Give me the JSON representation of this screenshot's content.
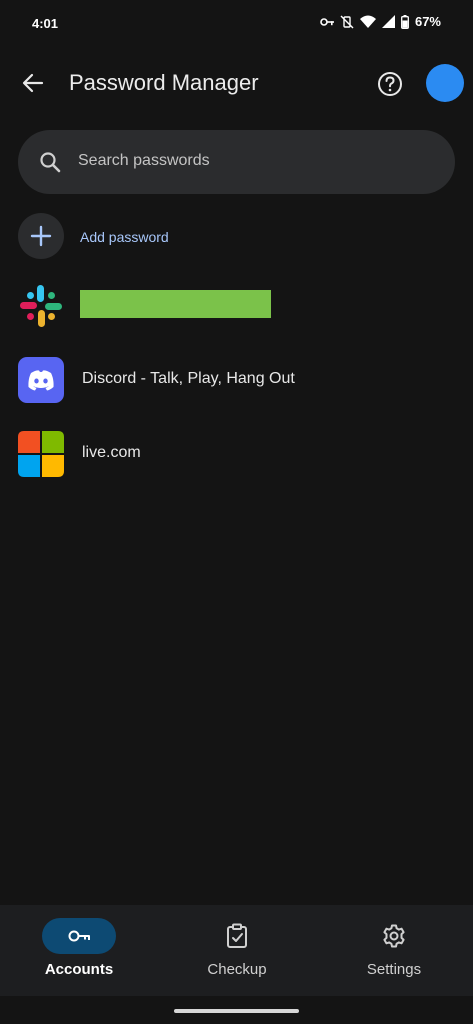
{
  "status_bar": {
    "time": "4:01",
    "battery": "67%",
    "icons": [
      "vpn-key-icon",
      "vibrate-off-icon",
      "wifi-icon",
      "signal-icon",
      "battery-icon"
    ]
  },
  "header": {
    "title": "Password Manager",
    "back_icon": "arrow-back-icon",
    "help_icon": "help-circle-icon",
    "avatar_color": "#2b8bf2"
  },
  "search": {
    "placeholder": "Search passwords"
  },
  "add_password": {
    "label": "Add password"
  },
  "passwords": [
    {
      "label": "",
      "icon": "slack-logo-icon",
      "redacted": true,
      "redaction_color": "#7bc24a"
    },
    {
      "label": "Discord - Talk, Play, Hang Out",
      "icon": "discord-logo-icon",
      "redacted": false
    },
    {
      "label": "live.com",
      "icon": "microsoft-logo-icon",
      "redacted": false
    }
  ],
  "bottom_nav": [
    {
      "label": "Accounts",
      "icon": "key-icon",
      "active": true
    },
    {
      "label": "Checkup",
      "icon": "clipboard-check-icon",
      "active": false
    },
    {
      "label": "Settings",
      "icon": "gear-icon",
      "active": false
    }
  ],
  "colors": {
    "background": "#141414",
    "surface": "#2b2c2e",
    "accent": "#a8c7fa",
    "nav_active": "#0d4a73"
  }
}
